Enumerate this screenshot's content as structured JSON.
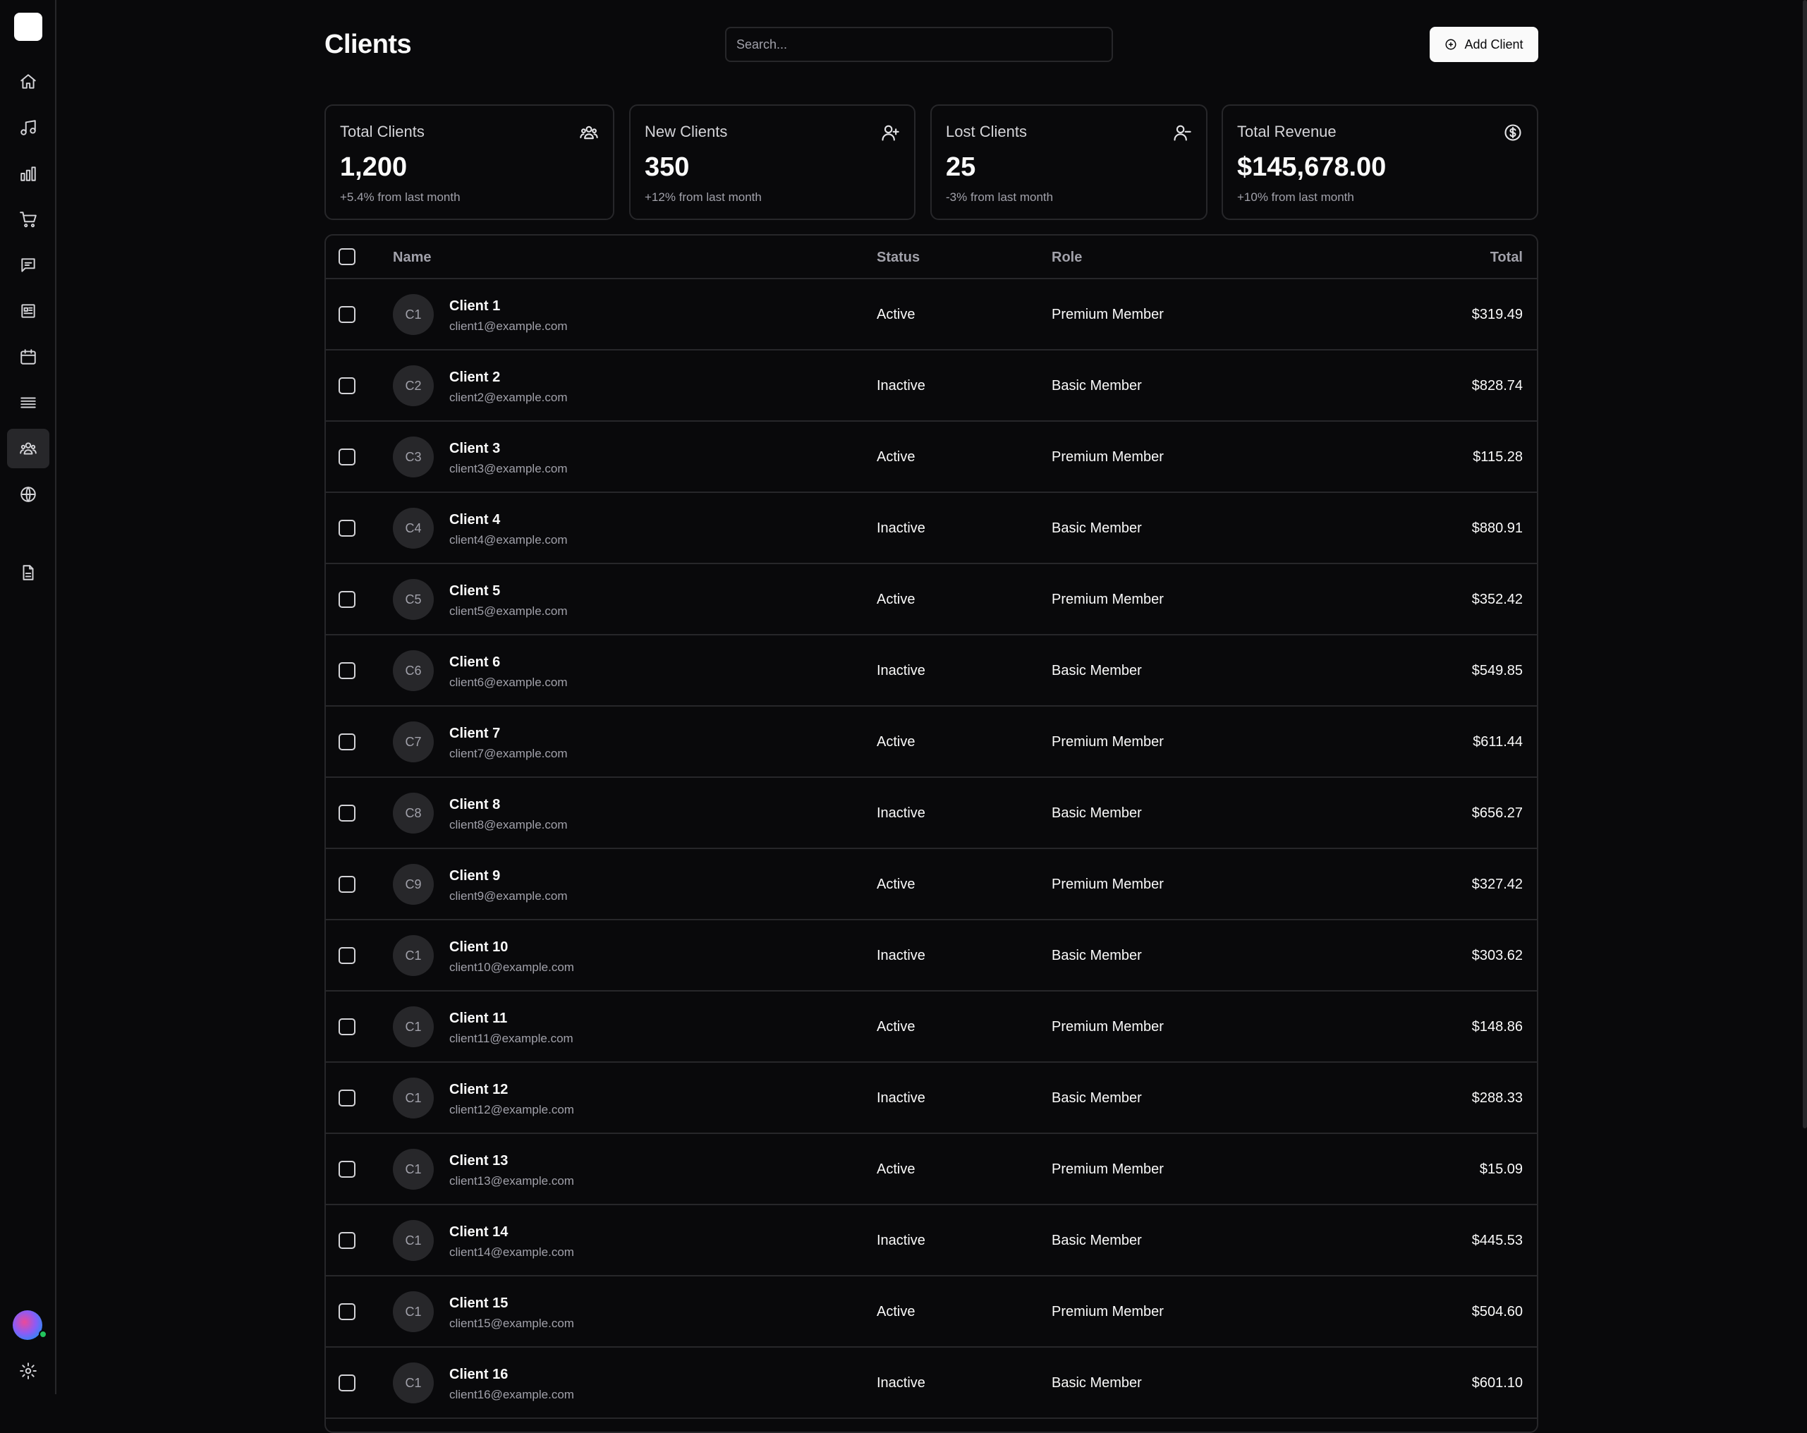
{
  "page": {
    "title": "Clients",
    "search_placeholder": "Search...",
    "add_button_label": "Add Client"
  },
  "sidebar": {
    "items": [
      {
        "name": "home",
        "icon": "home-icon"
      },
      {
        "name": "music",
        "icon": "music-icon"
      },
      {
        "name": "analytics",
        "icon": "bar-chart-icon"
      },
      {
        "name": "shop",
        "icon": "shopping-cart-icon"
      },
      {
        "name": "messages",
        "icon": "message-icon"
      },
      {
        "name": "news",
        "icon": "newspaper-icon"
      },
      {
        "name": "calendar",
        "icon": "calendar-icon"
      },
      {
        "name": "list",
        "icon": "list-icon"
      },
      {
        "name": "clients",
        "icon": "users-icon",
        "active": true
      },
      {
        "name": "globe",
        "icon": "globe-icon"
      },
      {
        "name": "documents",
        "icon": "file-icon"
      }
    ],
    "footer": [
      "user-avatar",
      "settings-icon"
    ]
  },
  "stats": [
    {
      "title": "Total Clients",
      "value": "1,200",
      "sub": "+5.4% from last month",
      "icon": "users-icon"
    },
    {
      "title": "New Clients",
      "value": "350",
      "sub": "+12% from last month",
      "icon": "user-plus-icon"
    },
    {
      "title": "Lost Clients",
      "value": "25",
      "sub": "-3% from last month",
      "icon": "user-minus-icon"
    },
    {
      "title": "Total Revenue",
      "value": "$145,678.00",
      "sub": "+10% from last month",
      "icon": "dollar-circle-icon"
    }
  ],
  "table": {
    "headers": {
      "name": "Name",
      "status": "Status",
      "role": "Role",
      "total": "Total"
    },
    "rows": [
      {
        "initials": "C1",
        "name": "Client 1",
        "email": "client1@example.com",
        "status": "Active",
        "role": "Premium Member",
        "total": "$319.49"
      },
      {
        "initials": "C2",
        "name": "Client 2",
        "email": "client2@example.com",
        "status": "Inactive",
        "role": "Basic Member",
        "total": "$828.74"
      },
      {
        "initials": "C3",
        "name": "Client 3",
        "email": "client3@example.com",
        "status": "Active",
        "role": "Premium Member",
        "total": "$115.28"
      },
      {
        "initials": "C4",
        "name": "Client 4",
        "email": "client4@example.com",
        "status": "Inactive",
        "role": "Basic Member",
        "total": "$880.91"
      },
      {
        "initials": "C5",
        "name": "Client 5",
        "email": "client5@example.com",
        "status": "Active",
        "role": "Premium Member",
        "total": "$352.42"
      },
      {
        "initials": "C6",
        "name": "Client 6",
        "email": "client6@example.com",
        "status": "Inactive",
        "role": "Basic Member",
        "total": "$549.85"
      },
      {
        "initials": "C7",
        "name": "Client 7",
        "email": "client7@example.com",
        "status": "Active",
        "role": "Premium Member",
        "total": "$611.44"
      },
      {
        "initials": "C8",
        "name": "Client 8",
        "email": "client8@example.com",
        "status": "Inactive",
        "role": "Basic Member",
        "total": "$656.27"
      },
      {
        "initials": "C9",
        "name": "Client 9",
        "email": "client9@example.com",
        "status": "Active",
        "role": "Premium Member",
        "total": "$327.42"
      },
      {
        "initials": "C1",
        "name": "Client 10",
        "email": "client10@example.com",
        "status": "Inactive",
        "role": "Basic Member",
        "total": "$303.62"
      },
      {
        "initials": "C1",
        "name": "Client 11",
        "email": "client11@example.com",
        "status": "Active",
        "role": "Premium Member",
        "total": "$148.86"
      },
      {
        "initials": "C1",
        "name": "Client 12",
        "email": "client12@example.com",
        "status": "Inactive",
        "role": "Basic Member",
        "total": "$288.33"
      },
      {
        "initials": "C1",
        "name": "Client 13",
        "email": "client13@example.com",
        "status": "Active",
        "role": "Premium Member",
        "total": "$15.09"
      },
      {
        "initials": "C1",
        "name": "Client 14",
        "email": "client14@example.com",
        "status": "Inactive",
        "role": "Basic Member",
        "total": "$445.53"
      },
      {
        "initials": "C1",
        "name": "Client 15",
        "email": "client15@example.com",
        "status": "Active",
        "role": "Premium Member",
        "total": "$504.60"
      },
      {
        "initials": "C1",
        "name": "Client 16",
        "email": "client16@example.com",
        "status": "Inactive",
        "role": "Basic Member",
        "total": "$601.10"
      }
    ]
  }
}
